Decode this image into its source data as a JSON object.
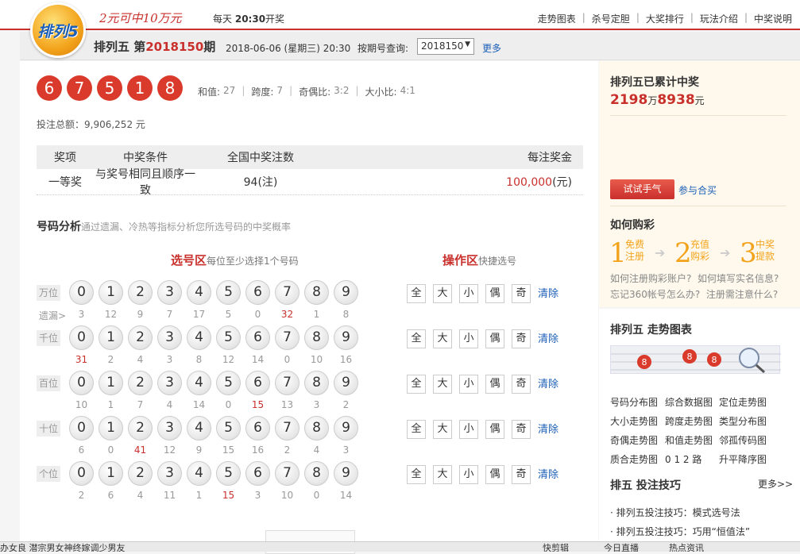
{
  "header": {
    "logo_text": "排列5",
    "slogan": "2元可中10万元",
    "daily_prefix": "每天",
    "daily_time": "20:30",
    "daily_suffix": "开奖",
    "nav": [
      "走势图表",
      "杀号定胆",
      "大奖排行",
      "玩法介绍",
      "中奖说明"
    ]
  },
  "draw": {
    "title_prefix": "排列五 第",
    "issue": "2018150",
    "title_suffix": "期",
    "date": "2018-06-06 (星期三) 20:30",
    "query_label": "按期号查询:",
    "select_value": "2018150",
    "more": "更多",
    "numbers": [
      "6",
      "7",
      "5",
      "1",
      "8"
    ],
    "stats": [
      {
        "label": "和值:",
        "value": "27"
      },
      {
        "label": "跨度:",
        "value": "7"
      },
      {
        "label": "奇偶比:",
        "value": "3:2"
      },
      {
        "label": "大小比:",
        "value": "4:1"
      }
    ],
    "total": "投注总额：9,906,252 元"
  },
  "prize": {
    "headers": [
      "奖项",
      "中奖条件",
      "全国中奖注数",
      "每注奖金"
    ],
    "row": {
      "level": "一等奖",
      "condition": "与奖号相同且顺序一致",
      "count": "94(注)",
      "amount": "100,000",
      "unit": "(元)"
    }
  },
  "analysis": {
    "title": "号码分析",
    "desc": "通过遗漏、冷热等指标分析您所选号码的中奖概率",
    "pick_title": "选号区",
    "pick_desc": "每位至少选择1个号码",
    "op_title": "操作区",
    "op_desc": "快捷选号",
    "miss_label": "遗漏>",
    "digits": [
      "0",
      "1",
      "2",
      "3",
      "4",
      "5",
      "6",
      "7",
      "8",
      "9"
    ],
    "quick": [
      "全",
      "大",
      "小",
      "偶",
      "奇"
    ],
    "clear": "清除",
    "rows": [
      {
        "label": "万位",
        "miss": [
          "3",
          "12",
          "9",
          "7",
          "17",
          "5",
          "0",
          "32",
          "1",
          "8"
        ],
        "hot": 7
      },
      {
        "label": "千位",
        "miss": [
          "31",
          "2",
          "4",
          "3",
          "8",
          "12",
          "14",
          "0",
          "10",
          "16"
        ],
        "hot": 0
      },
      {
        "label": "百位",
        "miss": [
          "10",
          "1",
          "7",
          "4",
          "14",
          "0",
          "15",
          "13",
          "3",
          "2"
        ],
        "hot": 6
      },
      {
        "label": "十位",
        "miss": [
          "6",
          "0",
          "41",
          "12",
          "9",
          "15",
          "16",
          "2",
          "4",
          "3"
        ],
        "hot": 2
      },
      {
        "label": "个位",
        "miss": [
          "2",
          "6",
          "4",
          "11",
          "1",
          "15",
          "3",
          "10",
          "0",
          "14"
        ],
        "hot": 5
      }
    ]
  },
  "side": {
    "cum_title": "排列五已累计中奖",
    "cum_a": "2198",
    "cum_a_unit": "万",
    "cum_b": "8938",
    "cum_b_unit": "元",
    "try_btn": "试试手气",
    "join": "参与合买",
    "how_title": "如何购彩",
    "steps": [
      {
        "num": "1",
        "label": "免费注册"
      },
      {
        "num": "2",
        "label": "充值购彩"
      },
      {
        "num": "3",
        "label": "中奖提款"
      }
    ],
    "faq1a": "如何注册购彩账户?",
    "faq1b": "如何填写实名信息?",
    "faq2a": "忘记360帐号怎么办?",
    "faq2b": "注册需注意什么?",
    "trend_title": "排列五 走势图表",
    "trend_links": [
      "号码分布图",
      "综合数据图",
      "定位走势图",
      "大小走势图",
      "跨度走势图",
      "类型分布图",
      "奇偶走势图",
      "和值走势图",
      "邻孤传码图",
      "质合走势图",
      "0 1 2 路",
      "升平降序图"
    ],
    "tips_title": "排五 投注技巧",
    "tips_more": "更多>>",
    "tips": [
      "· 排列五投注技巧：模式选号法",
      "· 排列五投注技巧：巧用“恒值法”"
    ]
  },
  "status": {
    "left": "办女良 潜宗男女神终嫁调少男友",
    "items": [
      "快剪辑",
      "今日直播",
      "热点资讯"
    ]
  }
}
